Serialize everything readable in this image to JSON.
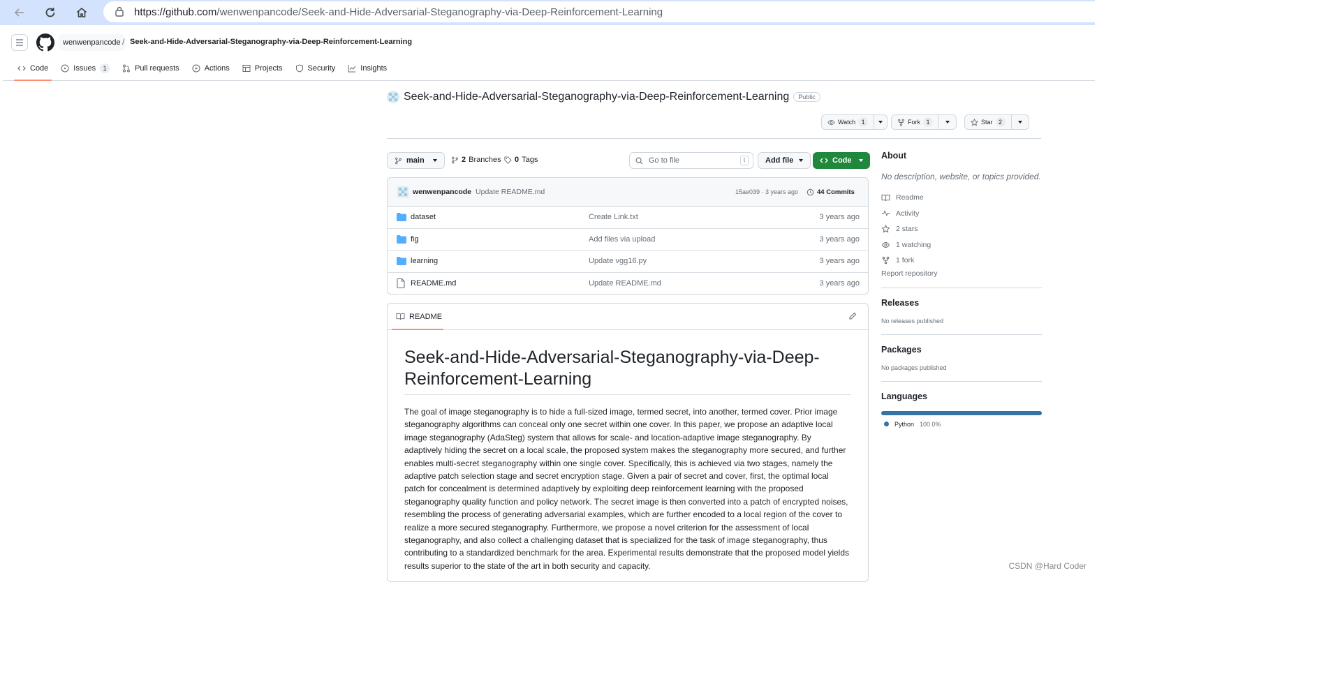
{
  "browser": {
    "url_host": "https://github.com",
    "url_path": "/wenwenpancode/Seek-and-Hide-Adversarial-Steganography-via-Deep-Reinforcement-Learning"
  },
  "header": {
    "owner": "wenwenpancode",
    "separator": "/",
    "repo": "Seek-and-Hide-Adversarial-Steganography-via-Deep-Reinforcement-Learning"
  },
  "tabs": [
    {
      "label": "Code",
      "active": true
    },
    {
      "label": "Issues",
      "count": "1"
    },
    {
      "label": "Pull requests"
    },
    {
      "label": "Actions"
    },
    {
      "label": "Projects"
    },
    {
      "label": "Security"
    },
    {
      "label": "Insights"
    }
  ],
  "repo": {
    "title": "Seek-and-Hide-Adversarial-Steganography-via-Deep-Reinforcement-Learning",
    "visibility": "Public",
    "watch_label": "Watch",
    "watch_count": "1",
    "fork_label": "Fork",
    "fork_count": "1",
    "star_label": "Star",
    "star_count": "2"
  },
  "toolbar": {
    "branch": "main",
    "branches_count": "2",
    "branches_label": "Branches",
    "tags_count": "0",
    "tags_label": "Tags",
    "goto_placeholder": "Go to file",
    "goto_key": "t",
    "add_file": "Add file",
    "code": "Code"
  },
  "latest_commit": {
    "author": "wenwenpancode",
    "message": "Update README.md",
    "hash_time": "15ae039 · 3 years ago",
    "commits": "44 Commits"
  },
  "files": [
    {
      "name": "dataset",
      "type": "folder",
      "message": "Create Link.txt",
      "age": "3 years ago"
    },
    {
      "name": "fig",
      "type": "folder",
      "message": "Add files via upload",
      "age": "3 years ago"
    },
    {
      "name": "learning",
      "type": "folder",
      "message": "Update vgg16.py",
      "age": "3 years ago"
    },
    {
      "name": "README.md",
      "type": "file",
      "message": "Update README.md",
      "age": "3 years ago"
    }
  ],
  "readme": {
    "tab_label": "README",
    "title": "Seek-and-Hide-Adversarial-Steganography-via-Deep-Reinforcement-Learning",
    "body": "The goal of image steganography is to hide a full-sized image, termed secret, into another, termed cover. Prior image steganography algorithms can conceal only one secret within one cover. In this paper, we propose an adaptive local image steganography (AdaSteg) system that allows for scale- and location-adaptive image steganography. By adaptively hiding the secret on a local scale, the proposed system makes the steganography more secured, and further enables multi-secret steganography within one single cover. Specifically, this is achieved via two stages, namely the adaptive patch selection stage and secret encryption stage. Given a pair of secret and cover, first, the optimal local patch for concealment is determined adaptively by exploiting deep reinforcement learning with the proposed steganography quality function and policy network. The secret image is then converted into a patch of encrypted noises, resembling the process of generating adversarial examples, which are further encoded to a local region of the cover to realize a more secured steganography. Furthermore, we propose a novel criterion for the assessment of local steganography, and also collect a challenging dataset that is specialized for the task of image steganography, thus contributing to a standardized benchmark for the area. Experimental results demonstrate that the proposed model yields results superior to the state of the art in both security and capacity."
  },
  "sidebar": {
    "about_title": "About",
    "about_desc": "No description, website, or topics provided.",
    "items": [
      {
        "icon": "book-icon",
        "label": "Readme"
      },
      {
        "icon": "pulse-icon",
        "label": "Activity"
      },
      {
        "icon": "star-icon",
        "label": "2 stars"
      },
      {
        "icon": "eye-icon",
        "label": "1 watching"
      },
      {
        "icon": "fork-icon",
        "label": "1 fork"
      }
    ],
    "report": "Report repository",
    "releases_title": "Releases",
    "releases_text": "No releases published",
    "packages_title": "Packages",
    "packages_text": "No packages published",
    "languages_title": "Languages",
    "language": {
      "name": "Python",
      "percent": "100.0%",
      "share": 1.0,
      "color": "#3572a5"
    }
  },
  "watermark": "CSDN @Hard Coder"
}
